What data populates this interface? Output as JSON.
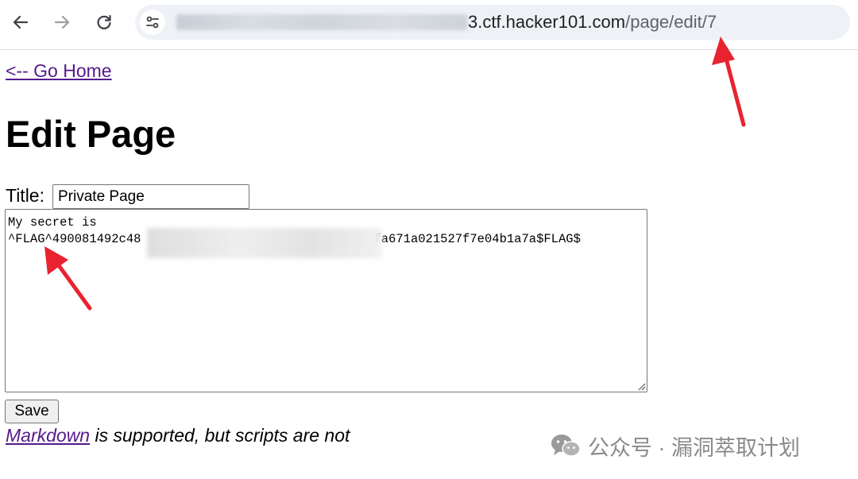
{
  "browser": {
    "url_host": "3.ctf.hacker101.com",
    "url_path": "/page/edit/7",
    "back_icon": "arrow-left",
    "forward_icon": "arrow-right",
    "reload_icon": "reload",
    "site_info_icon": "tune"
  },
  "page": {
    "home_link": "<-- Go Home",
    "heading": "Edit Page",
    "title_label": "Title:",
    "title_value": "Private Page",
    "body_line1": "My secret is",
    "body_line2_prefix": "^FLAG^490081492c48",
    "body_line2_suffix": "fa671a021527f7e04b1a7a$FLAG$",
    "save_label": "Save",
    "markdown_link": "Markdown",
    "help_suffix": " is supported, but scripts are not"
  },
  "annotation": {
    "arrow_color": "#e8232f"
  },
  "watermark": {
    "text": "公众号 · 漏洞萃取计划",
    "icon": "wechat-icon"
  }
}
